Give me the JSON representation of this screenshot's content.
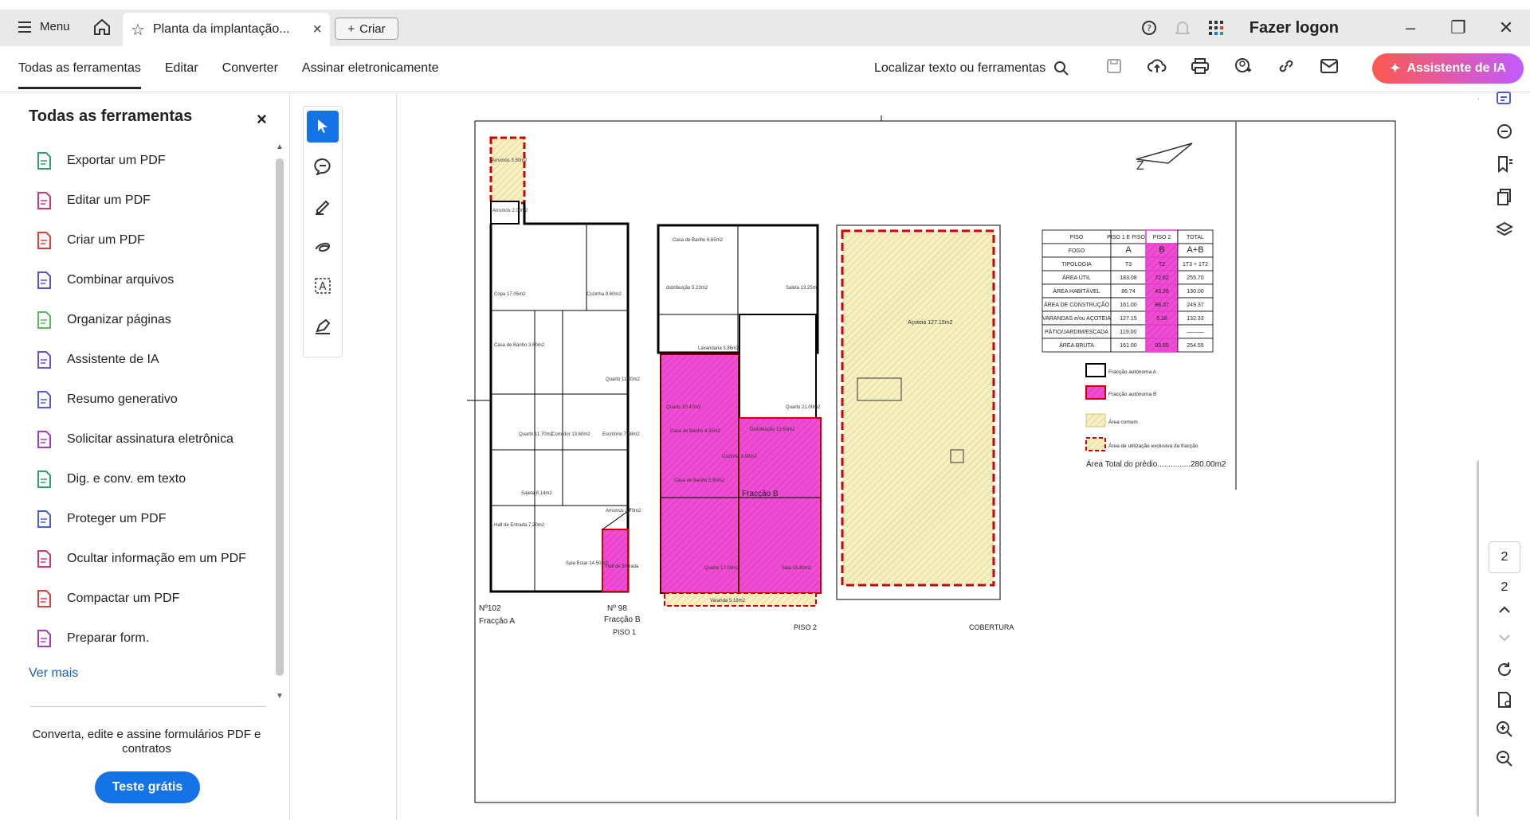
{
  "tabbar": {
    "menu_label": "Menu",
    "tab_title": "Planta da implantação...",
    "criar_label": "Criar",
    "login_label": "Fazer logon"
  },
  "toolbar": {
    "tabs": [
      "Todas as ferramentas",
      "Editar",
      "Converter",
      "Assinar eletronicamente"
    ],
    "search_label": "Localizar texto ou ferramentas",
    "ai_button": "Assistente de IA"
  },
  "sidebar": {
    "title": "Todas as ferramentas",
    "items": [
      {
        "label": "Exportar um PDF",
        "color": "#2e9e6b"
      },
      {
        "label": "Editar um PDF",
        "color": "#d6336c"
      },
      {
        "label": "Criar um PDF",
        "color": "#e03a3a"
      },
      {
        "label": "Combinar arquivos",
        "color": "#5a4fcf"
      },
      {
        "label": "Organizar páginas",
        "color": "#5cb85c"
      },
      {
        "label": "Assistente de IA",
        "color": "#6c4fd6"
      },
      {
        "label": "Resumo generativo",
        "color": "#4f5bd6"
      },
      {
        "label": "Solicitar assinatura eletrônica",
        "color": "#a23bc7"
      },
      {
        "label": "Dig. e conv. em texto",
        "color": "#2e9e6b"
      },
      {
        "label": "Proteger um PDF",
        "color": "#4f5bd6"
      },
      {
        "label": "Ocultar informação em um PDF",
        "color": "#d6336c"
      },
      {
        "label": "Compactar um PDF",
        "color": "#e03a3a"
      },
      {
        "label": "Preparar form.",
        "color": "#a23bc7"
      }
    ],
    "more_label": "Ver mais",
    "promo_text": "Converta, edite e assine formulários PDF e contratos",
    "trial_label": "Teste grátis"
  },
  "page_nav": {
    "current": "2",
    "total": "2"
  },
  "plan": {
    "floor_labels": [
      "PISO 1",
      "PISO 2",
      "COBERTURA"
    ],
    "fraccao_a": "Fracção A",
    "fraccao_b": "Fracção B",
    "fraccao_b_room": "Fracção B",
    "numbers": [
      "Nº102",
      "Nº 98"
    ],
    "rooms_piso1": [
      "Arrumos 3.50m2",
      "Arrumos 2.00m2",
      "Copa 17.05m2",
      "Cozinha 9.60m2",
      "Quarto 11.00m2",
      "Corredor 13.60m2",
      "Quarto 11.70m2",
      "Escritório 7.68m2",
      "Saleta 8.14m2",
      "Casa de Banho 3.60m2",
      "Arrumos 2.70m2",
      "Hall de Entrada 7.20m2",
      "Sala Estar 14.50m2",
      "Hall de Entrada"
    ],
    "rooms_piso2": [
      "Casa de Banho 6.65m2",
      "distribuição 5.23m2",
      "Saleta 13.25m2",
      "Lavandaria 3.86m2",
      "Quarto 10.47m2",
      "Quarto 21.00m2",
      "Casa de Banho 4.35m2",
      "Distribuição 13.60m2",
      "Casa de Banho 5.80m2",
      "Cozinha 3.00m2",
      "Quarto 17.00m2",
      "Sala 15.80m2",
      "Varanda 5.18m2"
    ],
    "rooms_cobertura": [
      "Açoteia 127.15m2"
    ],
    "legend": [
      "Fracção autónoma A",
      "Fracção autónoma B",
      "Área comum",
      "Área de utilização exclusiva da fracção"
    ],
    "total_text": "Área Total do prédio...............280.00m2",
    "table": {
      "headers": [
        "PISO",
        "PISO 1 E PISO 2",
        "PISO 2",
        "TOTAL"
      ],
      "rows": [
        [
          "FOGO",
          "A",
          "B",
          "A+B"
        ],
        [
          "TIPOLOGIA",
          "T3",
          "T2",
          "1T3 + 1T2"
        ],
        [
          "ÁREA ÚTIL",
          "183.08",
          "72.62",
          "255.70"
        ],
        [
          "ÁREA HABITÁVEL",
          "86.74",
          "43.26",
          "130.00"
        ],
        [
          "ÁREA DE CONSTRUÇÃO",
          "161.00",
          "88.37",
          "249.37"
        ],
        [
          "VARANDAS e/ou AÇOTEIA",
          "127.15",
          "5.18",
          "132.33"
        ],
        [
          "PÁTIO/JARDIM/ESCADA",
          "119.00",
          "",
          "———"
        ],
        [
          "ÁREA BRUTA",
          "161.00",
          "93.55",
          "254.55"
        ]
      ]
    }
  }
}
